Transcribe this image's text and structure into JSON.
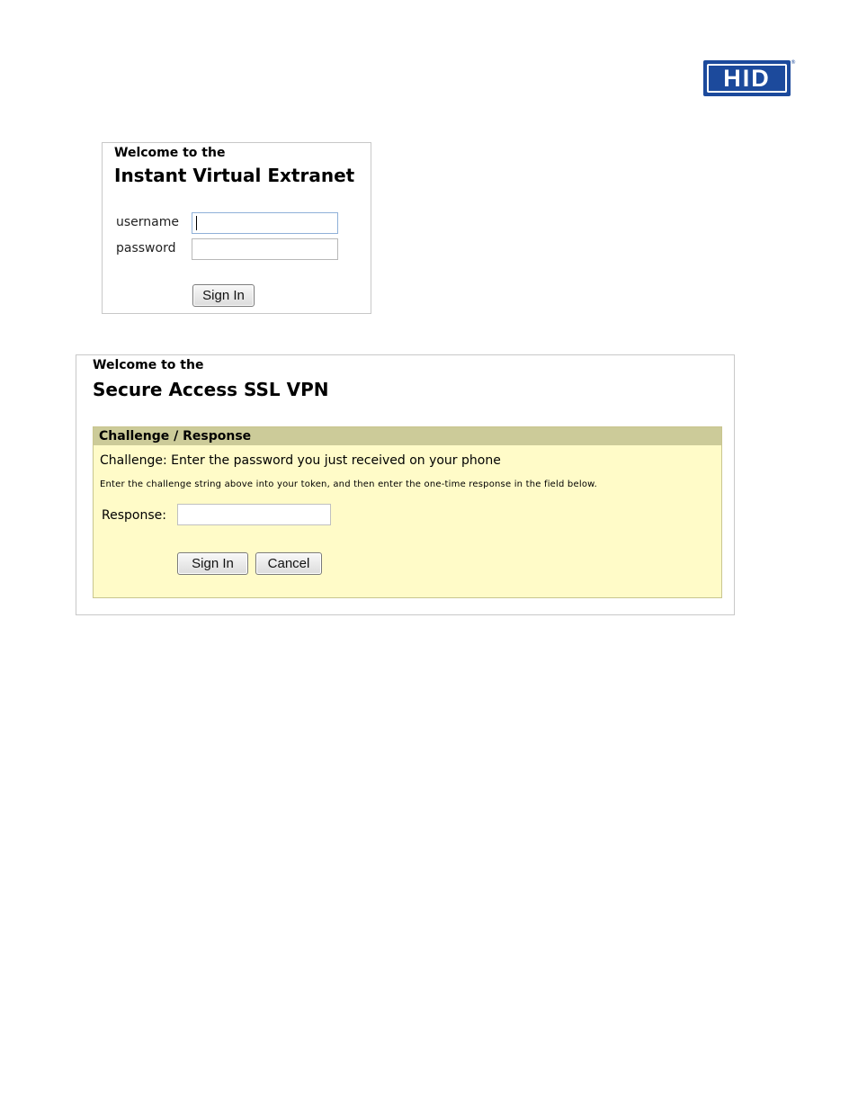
{
  "logo": {
    "text": "HID",
    "registered": "®"
  },
  "ive_login": {
    "welcome": "Welcome to the",
    "title": "Instant Virtual Extranet",
    "username_label": "username",
    "username_value": "",
    "password_label": "password",
    "password_value": "",
    "signin_label": "Sign In"
  },
  "ssl_vpn": {
    "welcome": "Welcome to the",
    "title": "Secure Access SSL VPN",
    "section_header": "Challenge / Response",
    "challenge_text": "Challenge: Enter the password you just received on your phone",
    "instructions": "Enter the challenge string above into your token, and then enter the one-time response in the field below.",
    "response_label": "Response:",
    "response_value": "",
    "signin_label": "Sign In",
    "cancel_label": "Cancel"
  },
  "colors": {
    "logo_blue": "#1c4a9c",
    "section_header_bg": "#cccb99",
    "section_bg": "#fffbc8"
  }
}
